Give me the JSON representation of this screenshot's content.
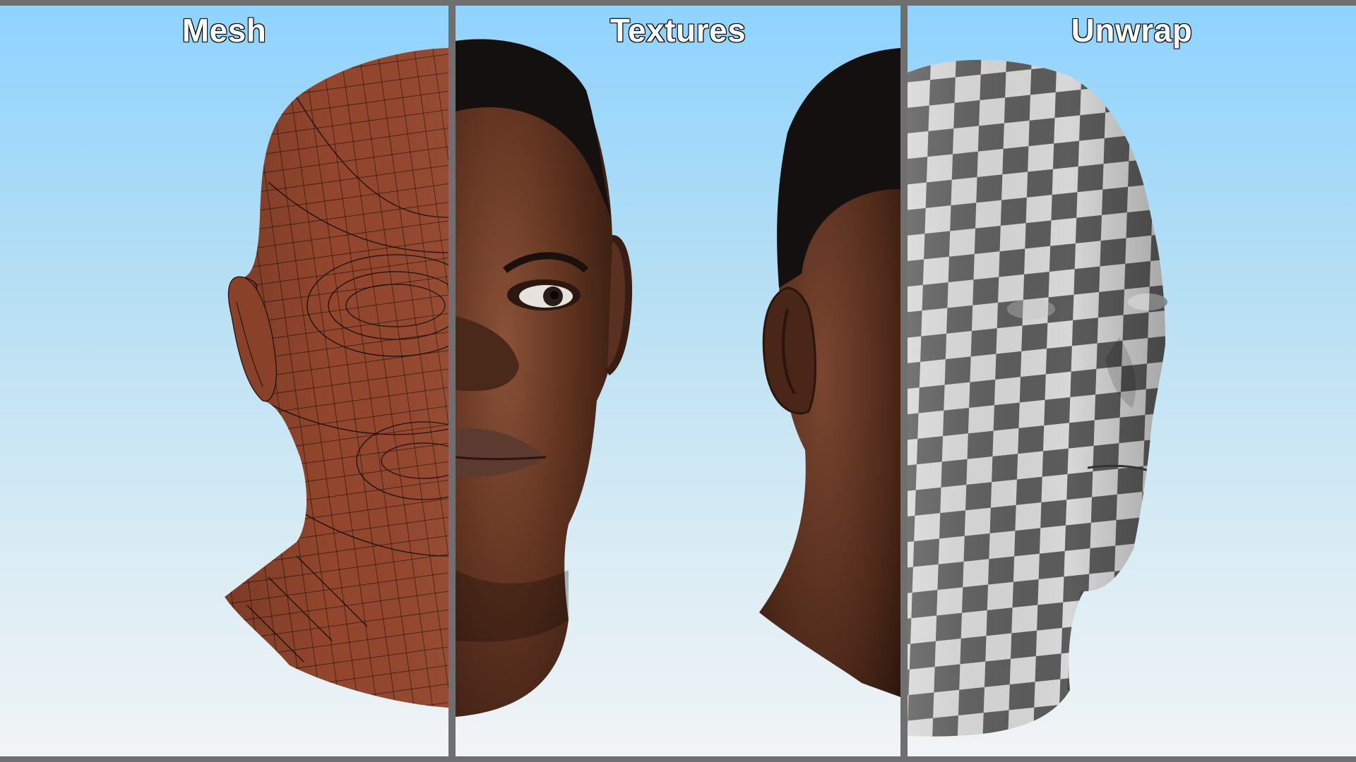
{
  "panels": [
    {
      "title": "Mesh",
      "render": "wireframe-head-half"
    },
    {
      "title": "Textures",
      "render": "textured-head-front-and-side"
    },
    {
      "title": "Unwrap",
      "render": "checker-uv-head"
    }
  ],
  "colors": {
    "sky_top": "#8fd3ff",
    "sky_bottom": "#f1f4f6",
    "divider": "#6f6f6f",
    "mesh_skin": "#93462d",
    "mesh_wire": "#1a0d08",
    "skin_dark": "#5a3120",
    "hair": "#141010",
    "checker_light": "#d8d8d8",
    "checker_dark": "#5c5c5c"
  }
}
